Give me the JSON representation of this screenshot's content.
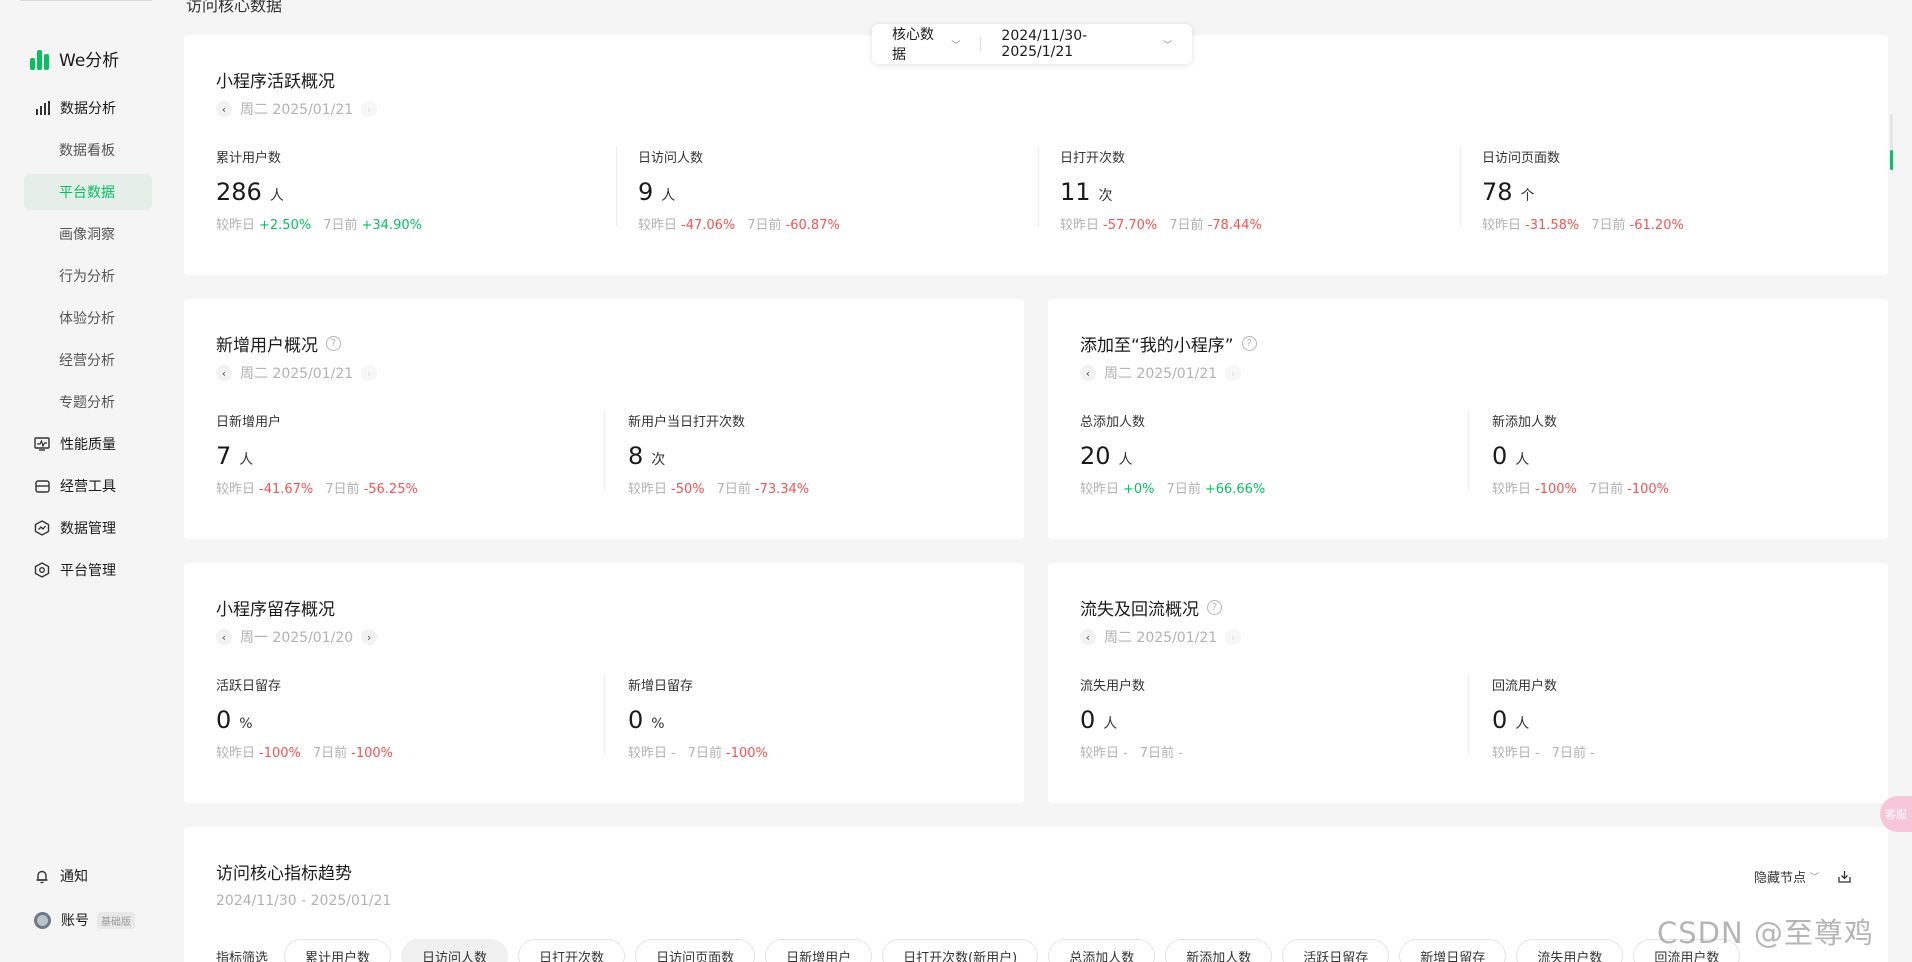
{
  "page": {
    "heading": "访问核心数据"
  },
  "brand": {
    "name": "We分析",
    "color": "#07c160"
  },
  "colors": {
    "up": "#07c160",
    "down": "#fa5151",
    "muted": "#b2b2b2"
  },
  "sidebar": {
    "groups": [
      {
        "label": "数据分析",
        "icon": "bar-chart-icon"
      },
      {
        "label": "性能质量",
        "icon": "monitor-icon"
      },
      {
        "label": "经营工具",
        "icon": "wallet-icon"
      },
      {
        "label": "数据管理",
        "icon": "hexagon-trend-icon"
      },
      {
        "label": "平台管理",
        "icon": "hexagon-gear-icon"
      }
    ],
    "subs": [
      "数据看板",
      "平台数据",
      "画像洞察",
      "行为分析",
      "体验分析",
      "经营分析",
      "专题分析"
    ],
    "active_sub": "平台数据",
    "notify": "通知",
    "account": "账号",
    "account_badge": "基础版"
  },
  "selector": {
    "type": "核心数据",
    "range": "2024/11/30- 2025/1/21"
  },
  "cmp_labels": {
    "yesterday": "较昨日",
    "week": "7日前"
  },
  "active": {
    "title": "小程序活跃概况",
    "date": "周二 2025/01/21",
    "metrics": [
      {
        "label": "累计用户数",
        "value": "286",
        "unit": "人",
        "day": "+2.50%",
        "week": "+34.90%"
      },
      {
        "label": "日访问人数",
        "value": "9",
        "unit": "人",
        "day": "-47.06%",
        "week": "-60.87%"
      },
      {
        "label": "日打开次数",
        "value": "11",
        "unit": "次",
        "day": "-57.70%",
        "week": "-78.44%"
      },
      {
        "label": "日访问页面数",
        "value": "78",
        "unit": "个",
        "day": "-31.58%",
        "week": "-61.20%"
      }
    ]
  },
  "new_users": {
    "title": "新增用户概况",
    "date": "周二 2025/01/21",
    "metrics": [
      {
        "label": "日新增用户",
        "value": "7",
        "unit": "人",
        "day": "-41.67%",
        "week": "-56.25%"
      },
      {
        "label": "新用户当日打开次数",
        "value": "8",
        "unit": "次",
        "day": "-50%",
        "week": "-73.34%"
      }
    ]
  },
  "add_mine": {
    "title": "添加至“我的小程序”",
    "date": "周二 2025/01/21",
    "metrics": [
      {
        "label": "总添加人数",
        "value": "20",
        "unit": "人",
        "day": "+0%",
        "week": "+66.66%"
      },
      {
        "label": "新添加人数",
        "value": "0",
        "unit": "人",
        "day": "-100%",
        "week": "-100%"
      }
    ]
  },
  "retention": {
    "title": "小程序留存概况",
    "date": "周一 2025/01/20",
    "metrics": [
      {
        "label": "活跃日留存",
        "value": "0",
        "unit": "%",
        "day": "-100%",
        "week": "-100%"
      },
      {
        "label": "新增日留存",
        "value": "0",
        "unit": "%",
        "day": "-",
        "week": "-100%"
      }
    ]
  },
  "churn": {
    "title": "流失及回流概况",
    "date": "周二 2025/01/21",
    "metrics": [
      {
        "label": "流失用户数",
        "value": "0",
        "unit": "人",
        "day": "-",
        "week": "-"
      },
      {
        "label": "回流用户数",
        "value": "0",
        "unit": "人",
        "day": "-",
        "week": "-"
      }
    ]
  },
  "trend": {
    "title": "访问核心指标趋势",
    "range": "2024/11/30 - 2025/01/21",
    "hide_nodes": "隐藏节点",
    "filter_label": "指标筛选",
    "chips": [
      "累计用户数",
      "日访问人数",
      "日打开次数",
      "日访问页面数",
      "日新增用户",
      "日打开次数(新用户)",
      "总添加人数",
      "新添加人数",
      "活跃日留存",
      "新增日留存",
      "流失用户数",
      "回流用户数"
    ],
    "active_chip": "日访问人数"
  },
  "float_button": "客服",
  "watermark": "CSDN @至尊鸡"
}
